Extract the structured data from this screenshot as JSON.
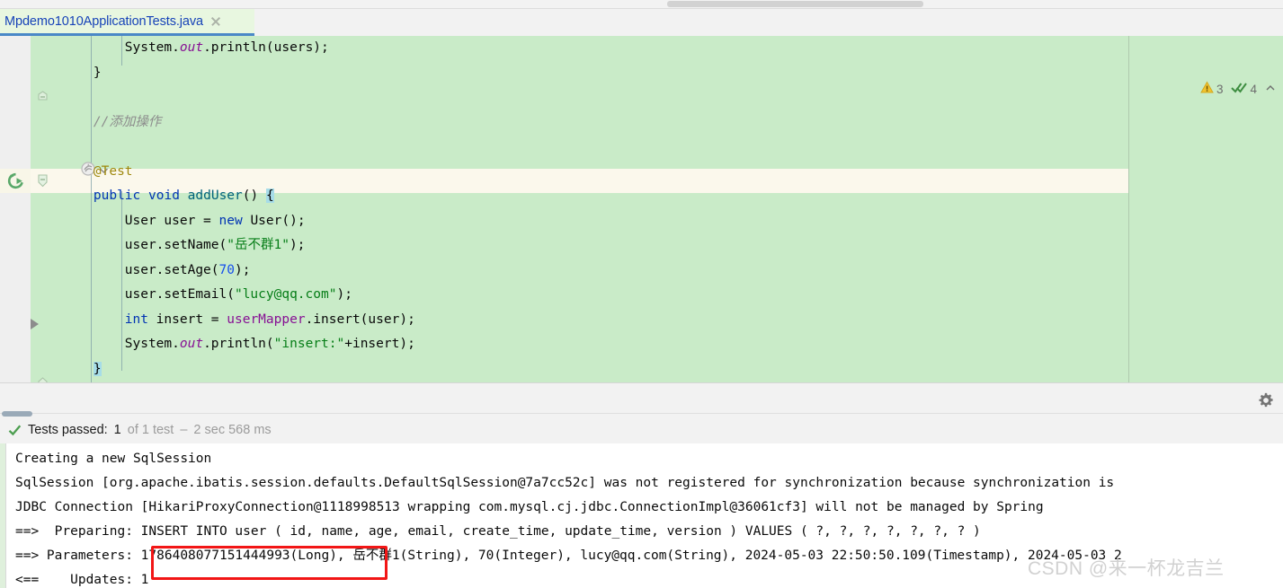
{
  "window": {
    "tab": {
      "label": "Mpdemo1010ApplicationTests.java",
      "close_icon": "close-icon"
    }
  },
  "inspections": {
    "warning_icon": "warning-triangle-icon",
    "warning_count": "3",
    "ok_icon": "double-check-icon",
    "ok_count": "4",
    "chevron": "chevron-up-icon"
  },
  "editor": {
    "lines": [
      {
        "indent": 8,
        "segments": [
          {
            "t": "System",
            "c": "pln"
          },
          {
            "t": ".",
            "c": "pln"
          },
          {
            "t": "out",
            "c": "stat"
          },
          {
            "t": ".println(users);",
            "c": "pln"
          }
        ]
      },
      {
        "indent": 4,
        "segments": [
          {
            "t": "}",
            "c": "pln"
          }
        ]
      },
      {
        "indent": 0,
        "segments": [
          {
            "t": "",
            "c": "pln"
          }
        ]
      },
      {
        "indent": 4,
        "segments": [
          {
            "t": "//添加操作",
            "c": "cmt"
          }
        ]
      },
      {
        "indent": 4,
        "segments": [
          {
            "t": "",
            "c": "pln"
          }
        ]
      },
      {
        "indent": 4,
        "segments": [
          {
            "t": "@Test",
            "c": "ann"
          }
        ]
      },
      {
        "indent": 4,
        "segments": [
          {
            "t": "public",
            "c": "kw"
          },
          {
            "t": " ",
            "c": "pln"
          },
          {
            "t": "void",
            "c": "kw"
          },
          {
            "t": " ",
            "c": "pln"
          },
          {
            "t": "addUser",
            "c": "meth"
          },
          {
            "t": "() ",
            "c": "pln"
          },
          {
            "t": "{",
            "c": "sel"
          }
        ]
      },
      {
        "indent": 8,
        "segments": [
          {
            "t": "User user = ",
            "c": "pln"
          },
          {
            "t": "new",
            "c": "kw"
          },
          {
            "t": " User();",
            "c": "pln"
          }
        ]
      },
      {
        "indent": 8,
        "segments": [
          {
            "t": "user.setName(",
            "c": "pln"
          },
          {
            "t": "\"岳不群1\"",
            "c": "str"
          },
          {
            "t": ");",
            "c": "pln"
          }
        ]
      },
      {
        "indent": 8,
        "segments": [
          {
            "t": "user.setAge(",
            "c": "pln"
          },
          {
            "t": "70",
            "c": "num"
          },
          {
            "t": ");",
            "c": "pln"
          }
        ]
      },
      {
        "indent": 8,
        "segments": [
          {
            "t": "user.setEmail(",
            "c": "pln"
          },
          {
            "t": "\"lucy@qq.com\"",
            "c": "str"
          },
          {
            "t": ");",
            "c": "pln"
          }
        ]
      },
      {
        "indent": 8,
        "segments": [
          {
            "t": "int",
            "c": "kw"
          },
          {
            "t": " insert = ",
            "c": "pln"
          },
          {
            "t": "userMapper",
            "c": "fld"
          },
          {
            "t": ".insert(user);",
            "c": "pln"
          }
        ]
      },
      {
        "indent": 8,
        "segments": [
          {
            "t": "System",
            "c": "pln"
          },
          {
            "t": ".",
            "c": "pln"
          },
          {
            "t": "out",
            "c": "stat"
          },
          {
            "t": ".println(",
            "c": "pln"
          },
          {
            "t": "\"insert:\"",
            "c": "str"
          },
          {
            "t": "+insert);",
            "c": "pln"
          }
        ]
      },
      {
        "indent": 4,
        "segments": [
          {
            "t": "}",
            "c": "sel"
          }
        ]
      }
    ],
    "gutter": {
      "run_test_icon": "run-test-icon",
      "spring_bean_icon": "spring-bean-icon",
      "spring_dropdown_icon": "chevron-down-icon",
      "fold_collapse_icon": "fold-collapse-icon",
      "fold_end_icon": "fold-end-icon",
      "breakpoint_triangle_icon": "fold-expand-triangle-icon"
    }
  },
  "toolbar": {
    "settings_icon": "gear-icon"
  },
  "test_status": {
    "icon": "green-check-icon",
    "label": "Tests passed:",
    "count": "1",
    "of_text": "of 1 test",
    "separator": "–",
    "duration": "2 sec 568 ms"
  },
  "console": {
    "lines": [
      "Creating a new SqlSession",
      "SqlSession [org.apache.ibatis.session.defaults.DefaultSqlSession@7a7cc52c] was not registered for synchronization because synchronization is",
      "JDBC Connection [HikariProxyConnection@1118998513 wrapping com.mysql.cj.jdbc.ConnectionImpl@36061cf3] will not be managed by Spring",
      "==>  Preparing: INSERT INTO user ( id, name, age, email, create_time, update_time, version ) VALUES ( ?, ?, ?, ?, ?, ?, ? )",
      "==> Parameters: 1786408077151444993(Long), 岳不群1(String), 70(Integer), lucy@qq.com(String), 2024-05-03 22:50:50.109(Timestamp), 2024-05-03 2",
      "<==    Updates: 1"
    ],
    "highlighted_value": "1786408077151444993(Long)"
  },
  "watermark": {
    "text": "CSDN @来一杯龙吉兰"
  },
  "colors": {
    "editor_bg": "#C9EBC8",
    "current_line": "#FBF8EC",
    "tab_bg": "#E8F7E0",
    "tab_text": "#1743B8",
    "tab_underline": "#4A88C7",
    "annotation_box": "#F21616",
    "keyword": "#0033B3",
    "string": "#067D17",
    "number": "#1750EB",
    "comment": "#8C8C8C",
    "annotation": "#9E880D",
    "field": "#871094",
    "warning": "#E8A317",
    "success": "#59A869"
  }
}
